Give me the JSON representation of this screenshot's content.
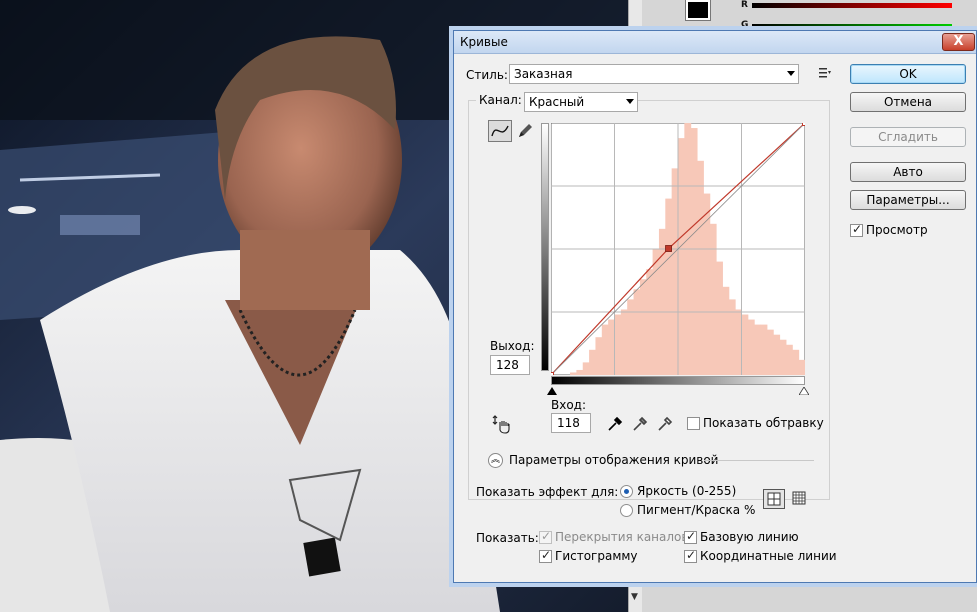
{
  "dialog": {
    "title": "Кривые",
    "close_glyph": "X",
    "style_label": "Стиль:",
    "style_value": "Заказная",
    "channel_label": "Канал:",
    "channel_value": "Красный",
    "output_label": "Выход:",
    "output_value": "128",
    "input_label": "Вход:",
    "input_value": "118",
    "show_clipping_label": "Показать обтравку",
    "show_clipping_checked": false,
    "curve_display_options_label": "Параметры отображения кривой",
    "show_amount_label": "Показать эффект для:",
    "amount_options": [
      {
        "label": "Яркость (0-255)",
        "selected": true
      },
      {
        "label": "Пигмент/Краска %",
        "selected": false
      }
    ],
    "show_label": "Показать:",
    "show_options": [
      {
        "label": "Перекрытия каналов",
        "checked": true,
        "disabled": true
      },
      {
        "label": "Базовую линию",
        "checked": true,
        "disabled": false
      },
      {
        "label": "Гистограмму",
        "checked": true,
        "disabled": false
      },
      {
        "label": "Координатные линии",
        "checked": true,
        "disabled": false
      }
    ],
    "buttons": {
      "ok": "OK",
      "cancel": "Отмена",
      "smooth": "Сгладить",
      "auto": "Авто",
      "options": "Параметры..."
    },
    "preview_label": "Просмотр",
    "preview_checked": true
  },
  "chart_data": {
    "type": "line",
    "xlim": [
      0,
      255
    ],
    "ylim": [
      0,
      255
    ],
    "grid": true,
    "series": [
      {
        "role": "curve",
        "color": "#c0392b",
        "x": [
          0,
          118,
          255
        ],
        "y": [
          0,
          128,
          255
        ]
      },
      {
        "role": "baseline",
        "color": "#8a8a8a",
        "x": [
          0,
          255
        ],
        "y": [
          0,
          255
        ]
      }
    ],
    "histogram": {
      "color": "#f7c8b8",
      "bins": [
        0,
        0,
        0,
        0.01,
        0.02,
        0.05,
        0.1,
        0.15,
        0.2,
        0.22,
        0.24,
        0.26,
        0.3,
        0.34,
        0.38,
        0.42,
        0.5,
        0.58,
        0.7,
        0.82,
        0.94,
        1.0,
        0.98,
        0.85,
        0.72,
        0.6,
        0.45,
        0.35,
        0.3,
        0.26,
        0.24,
        0.22,
        0.2,
        0.2,
        0.18,
        0.16,
        0.14,
        0.12,
        0.1,
        0.06
      ]
    },
    "control_points": [
      {
        "x": 118,
        "y": 128
      }
    ]
  },
  "colors": {
    "accent": "#1f5fb2",
    "curve": "#c0392b",
    "histogram": "#f7c8b8"
  }
}
